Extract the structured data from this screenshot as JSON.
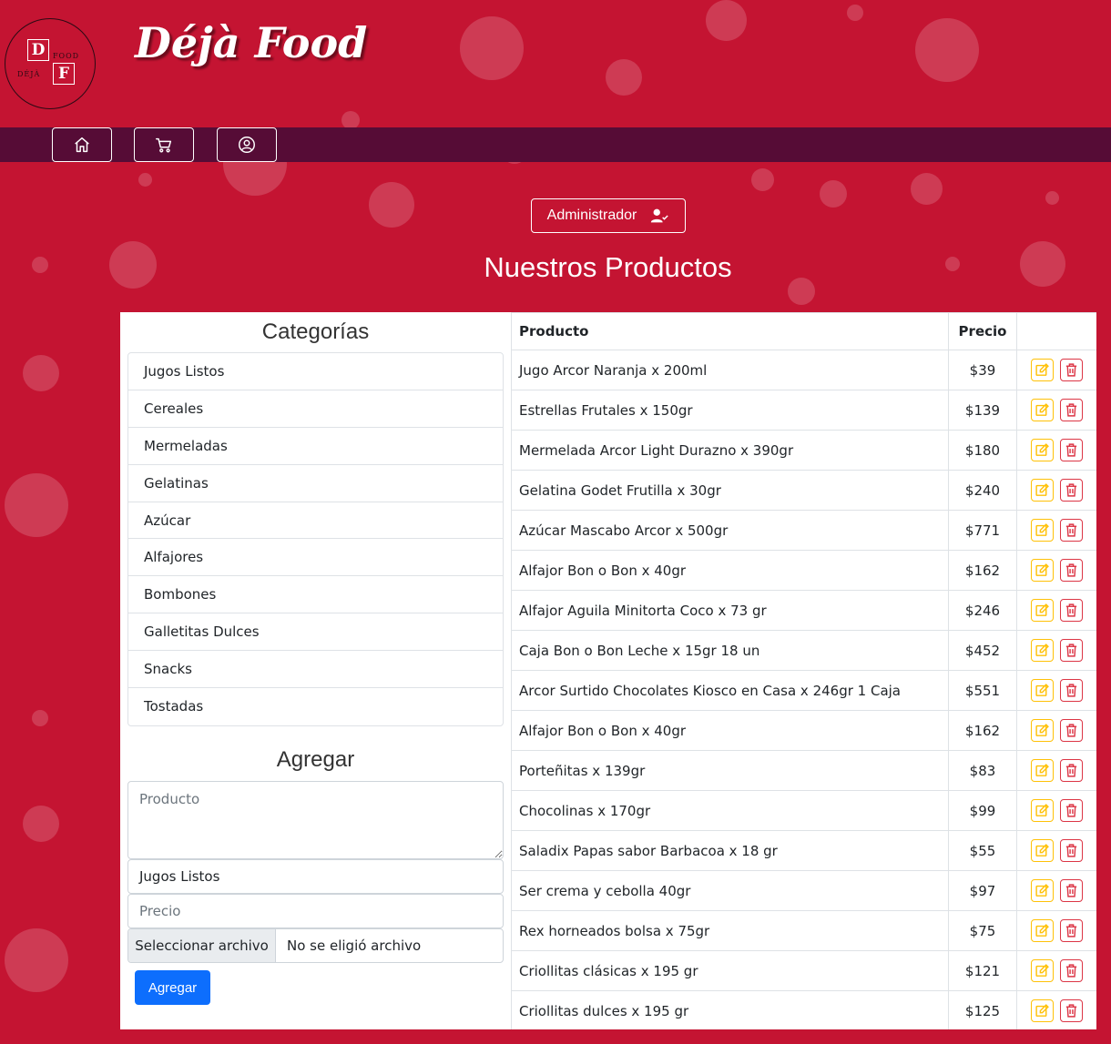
{
  "brand": {
    "title": "Déjà Food",
    "logo_letter_d": "D",
    "logo_letter_f": "F",
    "logo_word_food": "FOOD",
    "logo_word_deja": "DÉJÀ"
  },
  "nav": {
    "items": [
      {
        "icon": "home-icon"
      },
      {
        "icon": "cart-icon"
      },
      {
        "icon": "user-circle-icon"
      }
    ]
  },
  "admin": {
    "label": "Administrador",
    "icon": "user-check-icon"
  },
  "page_title": "Nuestros Productos",
  "categories": {
    "title": "Categorías",
    "items": [
      "Jugos Listos",
      "Cereales",
      "Mermeladas",
      "Gelatinas",
      "Azúcar",
      "Alfajores",
      "Bombones",
      "Galletitas Dulces",
      "Snacks",
      "Tostadas"
    ]
  },
  "add_form": {
    "title": "Agregar",
    "product_placeholder": "Producto",
    "category_selected": "Jugos Listos",
    "price_placeholder": "Precio",
    "file_button": "Seleccionar archivo",
    "file_status": "No se eligió archivo",
    "submit": "Agregar"
  },
  "table": {
    "headers": {
      "product": "Producto",
      "price": "Precio"
    },
    "rows": [
      {
        "name": "Jugo Arcor Naranja x 200ml",
        "price": "$39"
      },
      {
        "name": "Estrellas Frutales x 150gr",
        "price": "$139"
      },
      {
        "name": "Mermelada Arcor Light Durazno x 390gr",
        "price": "$180"
      },
      {
        "name": "Gelatina Godet Frutilla x 30gr",
        "price": "$240"
      },
      {
        "name": "Azúcar Mascabo Arcor x 500gr",
        "price": "$771"
      },
      {
        "name": "Alfajor Bon o Bon x 40gr",
        "price": "$162"
      },
      {
        "name": "Alfajor Aguila Minitorta Coco x 73 gr",
        "price": "$246"
      },
      {
        "name": "Caja Bon o Bon Leche x 15gr 18 un",
        "price": "$452"
      },
      {
        "name": "Arcor Surtido Chocolates Kiosco en Casa x 246gr 1 Caja",
        "price": "$551"
      },
      {
        "name": "Alfajor Bon o Bon x 40gr",
        "price": "$162"
      },
      {
        "name": "Porteñitas x 139gr",
        "price": "$83"
      },
      {
        "name": "Chocolinas x 170gr",
        "price": "$99"
      },
      {
        "name": "Saladix Papas sabor Barbacoa x 18 gr",
        "price": "$55"
      },
      {
        "name": "Ser crema y cebolla 40gr",
        "price": "$97"
      },
      {
        "name": "Rex horneados bolsa x 75gr",
        "price": "$75"
      },
      {
        "name": "Criollitas clásicas x 195 gr",
        "price": "$121"
      },
      {
        "name": "Criollitas dulces x 195 gr",
        "price": "$125"
      }
    ]
  },
  "colors": {
    "background": "#c41432",
    "navbar": "#560c36",
    "edit_button": "#ffc107",
    "delete_button": "#dc3545",
    "primary": "#0d6efd"
  }
}
